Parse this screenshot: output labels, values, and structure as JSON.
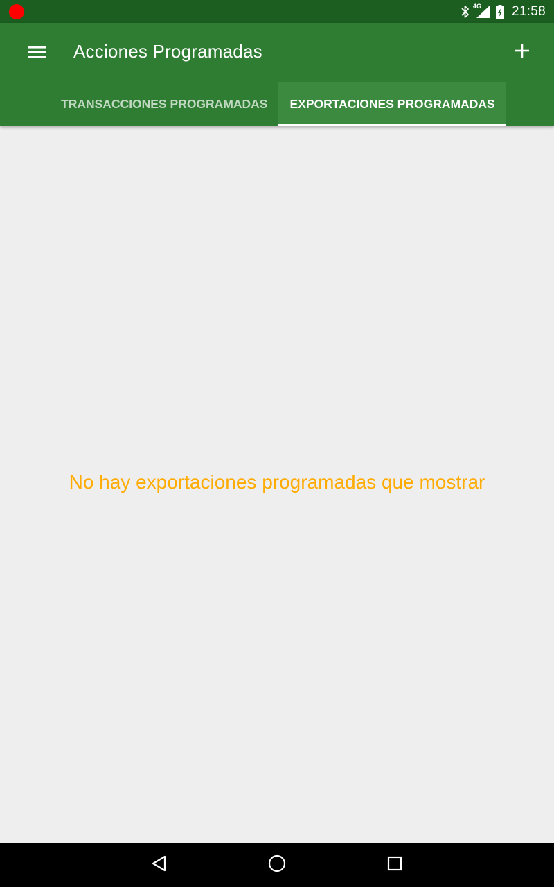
{
  "status_bar": {
    "time": "21:58",
    "network": "4G",
    "icons": [
      "recording-dot-icon",
      "bluetooth-icon",
      "cell-signal-icon",
      "battery-charging-icon"
    ],
    "recording_color": "#ff0000"
  },
  "app_bar": {
    "title": "Acciones Programadas",
    "color": "#2e7d32",
    "menu_icon": "hamburger-menu-icon",
    "add_icon": "plus-icon"
  },
  "tabs": [
    {
      "label": "TRANSACCIONES PROGRAMADAS",
      "active": false
    },
    {
      "label": "EXPORTACIONES PROGRAMADAS",
      "active": true
    }
  ],
  "content": {
    "empty_message": "No hay exportaciones programadas que mostrar",
    "empty_message_color": "#ffab00"
  },
  "nav_bar": {
    "icons": [
      "back-icon",
      "home-icon",
      "recents-icon"
    ]
  }
}
